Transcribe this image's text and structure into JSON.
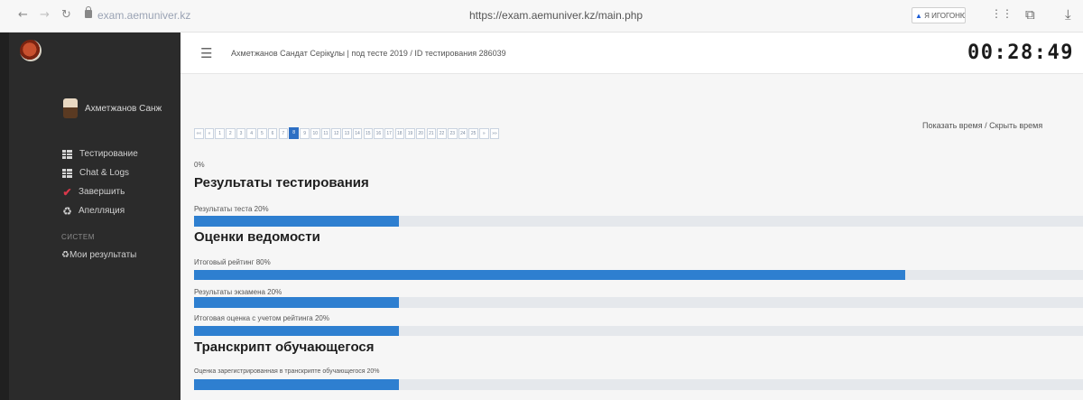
{
  "browser": {
    "address_short": "exam.aemuniver.kz",
    "address_full": "https://exam.aemuniver.kz/main.php",
    "extension_label": "Я ИГОГОНЮЮ",
    "nav": {
      "back": "←",
      "forward": "→",
      "reload": "↻"
    },
    "icons": [
      "arrow-left-icon",
      "arrow-right-icon",
      "reload-icon",
      "lock-icon",
      "bookmarks-icon",
      "translate-icon",
      "download-icon"
    ]
  },
  "sidebar": {
    "user_name": "Ахметжанов Санж",
    "menu": [
      {
        "label": "Тестирование",
        "icon": "grid-icon"
      },
      {
        "label": "Chat & Logs",
        "icon": "grid-icon"
      },
      {
        "label": "Завершить",
        "icon": "check-icon"
      },
      {
        "label": "Апелляция",
        "icon": "recycle-icon"
      }
    ],
    "section_title": "СИСТЕМ",
    "menu2": [
      {
        "label": "Мои результаты",
        "icon": "recycle-icon"
      }
    ]
  },
  "header": {
    "burger_icon": "menu-icon",
    "breadcrumb": "Ахметжанов Сандат Серікұлы | под тесте 2019 / ID тестирования 286039",
    "timer": "00:28:49"
  },
  "main": {
    "toggle_show": "Показать время",
    "toggle_sep": "/",
    "toggle_hide": "Скрыть время",
    "pager": {
      "items": [
        "««",
        "«",
        "1",
        "2",
        "3",
        "4",
        "5",
        "6",
        "7",
        "8",
        "9",
        "10",
        "11",
        "12",
        "13",
        "14",
        "15",
        "16",
        "17",
        "18",
        "19",
        "20",
        "21",
        "22",
        "23",
        "24",
        "25",
        "»",
        "»»"
      ],
      "active": "8"
    },
    "pct_prefix": "0%",
    "section1": {
      "title": "Результаты тестирования",
      "bars": [
        {
          "label": "Результаты теста 20%",
          "progress_fraction": 0.23
        }
      ]
    },
    "section2": {
      "title": "Оценки ведомости",
      "bars": [
        {
          "label": "Итоговый рейтинг 80%",
          "progress_fraction": 0.8
        },
        {
          "label": "Результаты экзамена 20%",
          "progress_fraction": 0.23
        },
        {
          "label": "Итоговая оценка с учетом рейтинга 20%",
          "progress_fraction": 0.23
        }
      ]
    },
    "section3": {
      "title": "Транскрипт обучающегося",
      "bars": [
        {
          "label": "Оценка зарегистрированная в транскрипте обучающегося 20%",
          "progress_fraction": 0.23
        }
      ]
    }
  },
  "colors": {
    "sidebar_bg": "#2b2b2b",
    "progress_fill": "#2e7fd0",
    "progress_track": "#e5e8ec",
    "pager_active": "#2d6fc4",
    "check_icon": "#d9384a"
  }
}
